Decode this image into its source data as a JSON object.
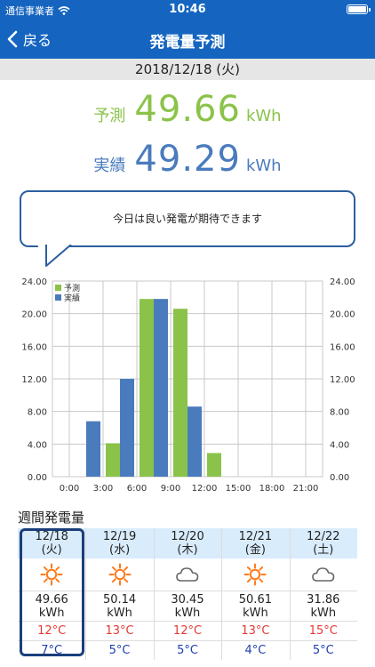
{
  "status": {
    "carrier": "通信事業者",
    "time": "10:46"
  },
  "nav": {
    "back_label": "戻る",
    "title": "発電量予測"
  },
  "date": "2018/12/18 (火)",
  "summary": {
    "forecast": {
      "label": "予測",
      "value": "49.66",
      "unit": "kWh"
    },
    "actual": {
      "label": "実績",
      "value": "49.29",
      "unit": "kWh"
    }
  },
  "message": "今日は良い発電が期待できます",
  "colors": {
    "header": "#1565c0",
    "forecast": "#8bc34a",
    "actual": "#4a7bbd",
    "high": "#e53935",
    "low": "#1e3fae",
    "sun": "#ff7a1a"
  },
  "chart_data": {
    "type": "bar",
    "x_ticks": [
      "0:00",
      "3:00",
      "6:00",
      "9:00",
      "12:00",
      "15:00",
      "18:00",
      "21:00"
    ],
    "y_ticks": [
      "0.00",
      "4.00",
      "8.00",
      "12.00",
      "16.00",
      "20.00",
      "24.00"
    ],
    "ylim": [
      0,
      24
    ],
    "legend_position": "top-left",
    "slot_hours": [
      3,
      6,
      9,
      12,
      15
    ],
    "series": [
      {
        "name": "予測",
        "color": "#8bc34a",
        "values": [
          0,
          4.1,
          21.8,
          20.6,
          2.9
        ]
      },
      {
        "name": "実績",
        "color": "#4a7bbd",
        "values": [
          6.8,
          12.0,
          21.8,
          8.6,
          0
        ]
      }
    ]
  },
  "weekly": {
    "title": "週間発電量",
    "days": [
      {
        "date": "12/18",
        "weekday": "(火)",
        "icon": "sun-icon",
        "energy": "49.66",
        "unit": "kWh",
        "high": "12°C",
        "low": "7°C",
        "selected": true
      },
      {
        "date": "12/19",
        "weekday": "(水)",
        "icon": "sun-icon",
        "energy": "50.14",
        "unit": "kWh",
        "high": "13°C",
        "low": "5°C"
      },
      {
        "date": "12/20",
        "weekday": "(木)",
        "icon": "cloud-icon",
        "energy": "30.45",
        "unit": "kWh",
        "high": "12°C",
        "low": "5°C"
      },
      {
        "date": "12/21",
        "weekday": "(金)",
        "icon": "sun-icon",
        "energy": "50.61",
        "unit": "kWh",
        "high": "13°C",
        "low": "4°C"
      },
      {
        "date": "12/22",
        "weekday": "(土)",
        "icon": "cloud-icon",
        "energy": "31.86",
        "unit": "kWh",
        "high": "15°C",
        "low": "5°C"
      }
    ]
  }
}
